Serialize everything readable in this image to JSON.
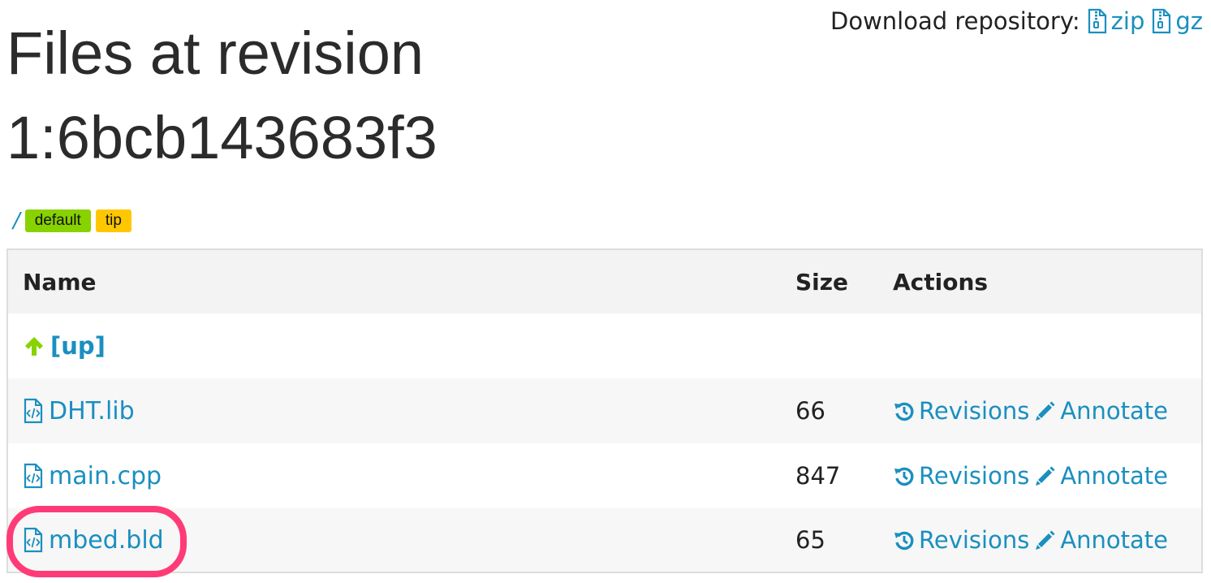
{
  "page": {
    "title_line1": "Files at revision",
    "title_line2": "1:6bcb143683f3"
  },
  "download": {
    "label": "Download repository:",
    "zip": "zip",
    "gz": "gz"
  },
  "breadcrumb": {
    "root": "/",
    "branch": "default",
    "tag": "tip"
  },
  "colors": {
    "link": "#1a8fc0",
    "branch_badge": "#88d200",
    "tag_badge": "#ffc700",
    "up_arrow": "#88d200",
    "highlight": "#ff3b77"
  },
  "table": {
    "headers": {
      "name": "Name",
      "size": "Size",
      "actions": "Actions"
    },
    "up_label": "[up]",
    "rows": [
      {
        "name": "DHT.lib",
        "size": "66",
        "revisions": "Revisions",
        "annotate": "Annotate"
      },
      {
        "name": "main.cpp",
        "size": "847",
        "revisions": "Revisions",
        "annotate": "Annotate"
      },
      {
        "name": "mbed.bld",
        "size": "65",
        "revisions": "Revisions",
        "annotate": "Annotate"
      }
    ]
  },
  "icons": {
    "archive": "zip-file-icon",
    "file": "code-file-icon",
    "up": "arrow-up-icon",
    "history": "history-icon",
    "annotate": "pencil-icon"
  }
}
